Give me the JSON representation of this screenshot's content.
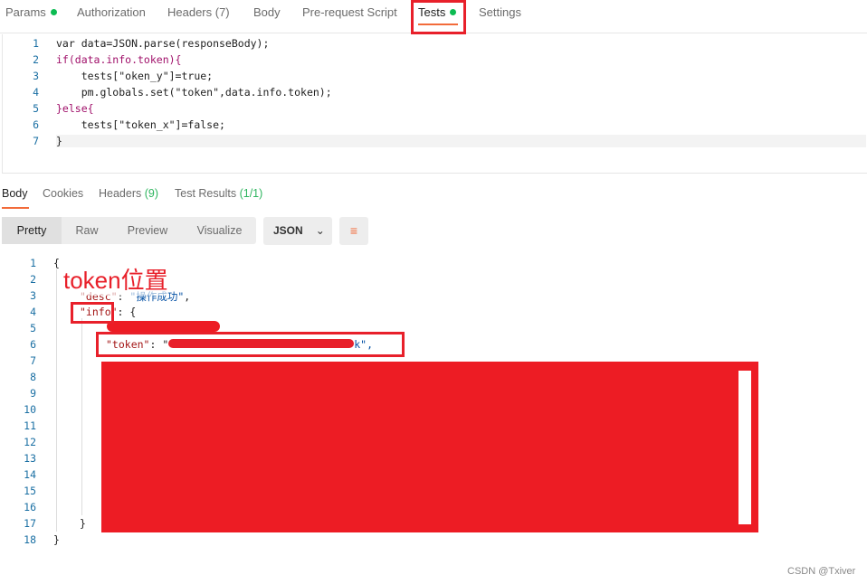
{
  "request_tabs": [
    {
      "label": "Params",
      "dot": true
    },
    {
      "label": "Authorization"
    },
    {
      "label": "Headers (7)"
    },
    {
      "label": "Body"
    },
    {
      "label": "Pre-request Script"
    },
    {
      "label": "Tests",
      "dot": true,
      "active": true
    },
    {
      "label": "Settings"
    }
  ],
  "script_lines": [
    "var data=JSON.parse(responseBody);",
    "if(data.info.token){",
    "    tests[\"oken_y\"]=true;",
    "    pm.globals.set(\"token\",data.info.token);",
    "}else{",
    "    tests[\"token_x\"]=false;",
    "}"
  ],
  "response_tabs": [
    {
      "label": "Body",
      "active": true
    },
    {
      "label": "Cookies"
    },
    {
      "label": "Headers",
      "count": "(9)"
    },
    {
      "label": "Test Results",
      "count": "(1/1)"
    }
  ],
  "view_modes": [
    "Pretty",
    "Raw",
    "Preview",
    "Visualize"
  ],
  "format": "JSON",
  "json_lines": {
    "l3_key": "\"desc\"",
    "l3_val": "\"操作成功\"",
    "l4_key": "\"info\"",
    "l6_key": "\"token\"",
    "l6_tail": "k\","
  },
  "annotation": "token位置",
  "watermark": "CSDN @Txiver",
  "colors": {
    "accent": "#f26b3a",
    "annotation": "#e8202a",
    "dot": "#0cbb52"
  }
}
